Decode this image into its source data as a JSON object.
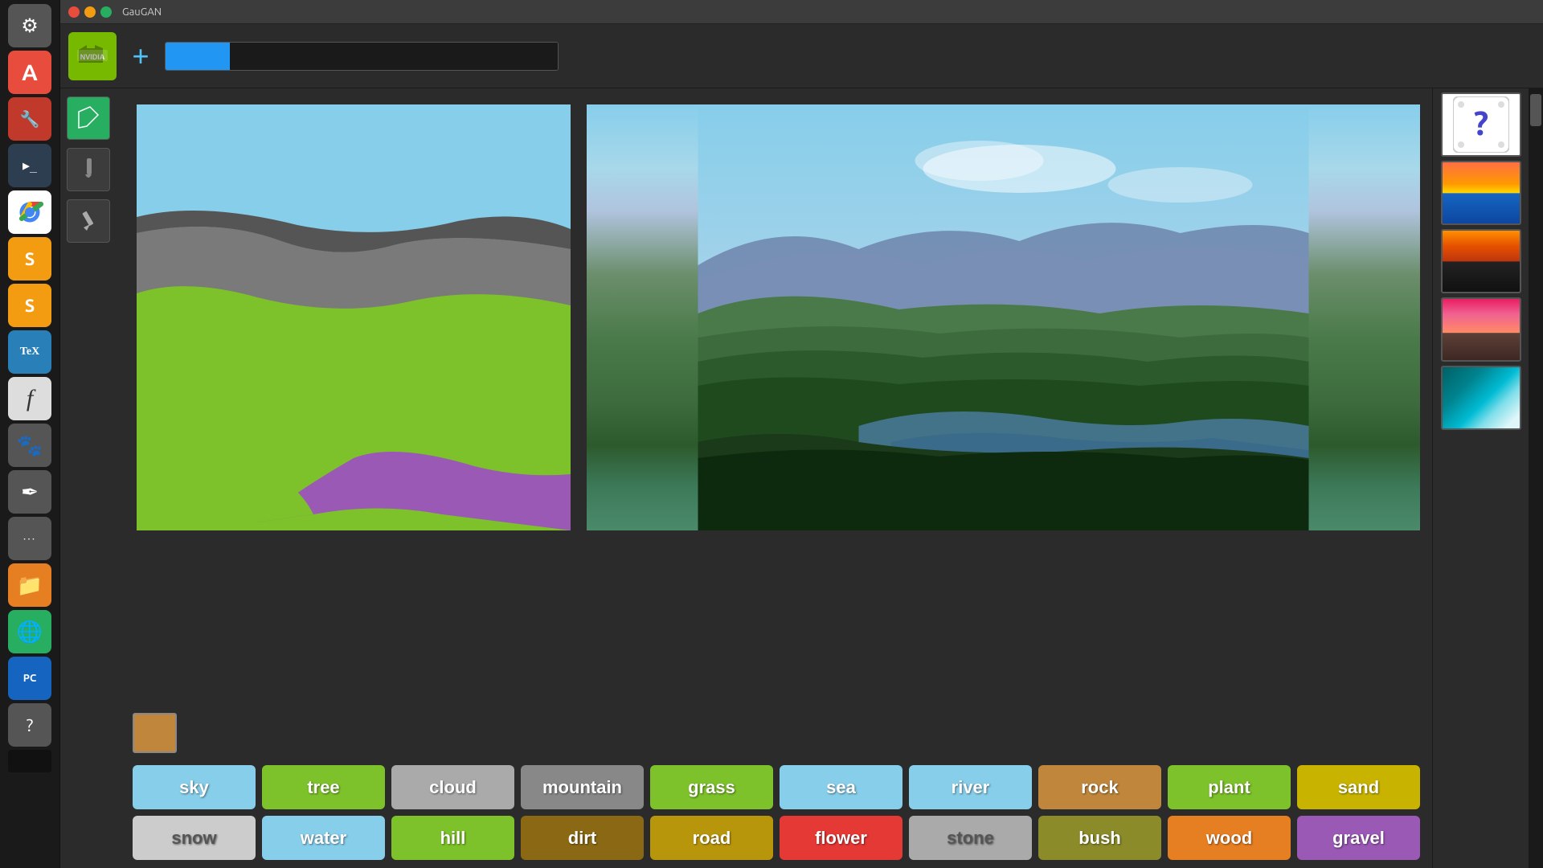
{
  "window": {
    "title": "GauGAN",
    "close_label": "×",
    "minimize_label": "−",
    "maximize_label": "□"
  },
  "toolbar": {
    "plus_label": "+",
    "nvidia_label": "NVIDIA"
  },
  "tools": [
    {
      "name": "fill-tool",
      "icon": "◆",
      "active": true
    },
    {
      "name": "brush-tool",
      "icon": "✏",
      "active": false
    },
    {
      "name": "pencil-tool",
      "icon": "✏",
      "active": false
    }
  ],
  "selected_color": "#c0873c",
  "labels_row1": [
    {
      "id": "sky",
      "label": "sky",
      "class": "sky"
    },
    {
      "id": "tree",
      "label": "tree",
      "class": "tree"
    },
    {
      "id": "cloud",
      "label": "cloud",
      "class": "cloud"
    },
    {
      "id": "mountain",
      "label": "mountain",
      "class": "mountain"
    },
    {
      "id": "grass",
      "label": "grass",
      "class": "grass"
    },
    {
      "id": "sea",
      "label": "sea",
      "class": "sea"
    },
    {
      "id": "river",
      "label": "river",
      "class": "river"
    },
    {
      "id": "rock",
      "label": "rock",
      "class": "rock"
    },
    {
      "id": "plant",
      "label": "plant",
      "class": "plant"
    },
    {
      "id": "sand",
      "label": "sand",
      "class": "sand"
    }
  ],
  "labels_row2": [
    {
      "id": "snow",
      "label": "snow",
      "class": "snow"
    },
    {
      "id": "water",
      "label": "water",
      "class": "water"
    },
    {
      "id": "hill",
      "label": "hill",
      "class": "hill"
    },
    {
      "id": "dirt",
      "label": "dirt",
      "class": "dirt"
    },
    {
      "id": "road",
      "label": "road",
      "class": "road"
    },
    {
      "id": "flower",
      "label": "flower",
      "class": "flower"
    },
    {
      "id": "stone",
      "label": "stone",
      "class": "stone"
    },
    {
      "id": "bush",
      "label": "bush",
      "class": "bush"
    },
    {
      "id": "wood",
      "label": "wood",
      "class": "wood"
    },
    {
      "id": "gravel",
      "label": "gravel",
      "class": "gravel"
    }
  ],
  "thumbnails": [
    {
      "id": "random-dice",
      "type": "dice",
      "icon": "?"
    },
    {
      "id": "thumb-sunset",
      "type": "sunset"
    },
    {
      "id": "thumb-mountain",
      "type": "mountain"
    },
    {
      "id": "thumb-beach",
      "type": "beach"
    },
    {
      "id": "thumb-wave",
      "type": "wave"
    }
  ],
  "dock_icons": [
    {
      "name": "settings",
      "icon": "⚙",
      "class": "settings"
    },
    {
      "name": "font-manager",
      "icon": "A",
      "class": "font"
    },
    {
      "name": "tools",
      "icon": "🔧",
      "class": "tool"
    },
    {
      "name": "terminal",
      "icon": ">_",
      "class": "terminal"
    },
    {
      "name": "chrome",
      "icon": "◎",
      "class": "chrome"
    },
    {
      "name": "sublime1",
      "icon": "S",
      "class": "sublime"
    },
    {
      "name": "sublime2",
      "icon": "S",
      "class": "sublime2"
    },
    {
      "name": "texmaker",
      "icon": "TeX",
      "class": "tex"
    },
    {
      "name": "font-viewer",
      "icon": "f",
      "class": "font2"
    },
    {
      "name": "gimp",
      "icon": "🎨",
      "class": "gimp"
    },
    {
      "name": "stylus",
      "icon": "✒",
      "class": "pen"
    },
    {
      "name": "dots-app",
      "icon": "···",
      "class": "dots"
    },
    {
      "name": "file-manager",
      "icon": "📁",
      "class": "orange-folder"
    },
    {
      "name": "globe",
      "icon": "🌐",
      "class": "globe"
    },
    {
      "name": "pc-manager",
      "icon": "PC",
      "class": "pc"
    },
    {
      "name": "help",
      "icon": "?",
      "class": "help"
    }
  ]
}
